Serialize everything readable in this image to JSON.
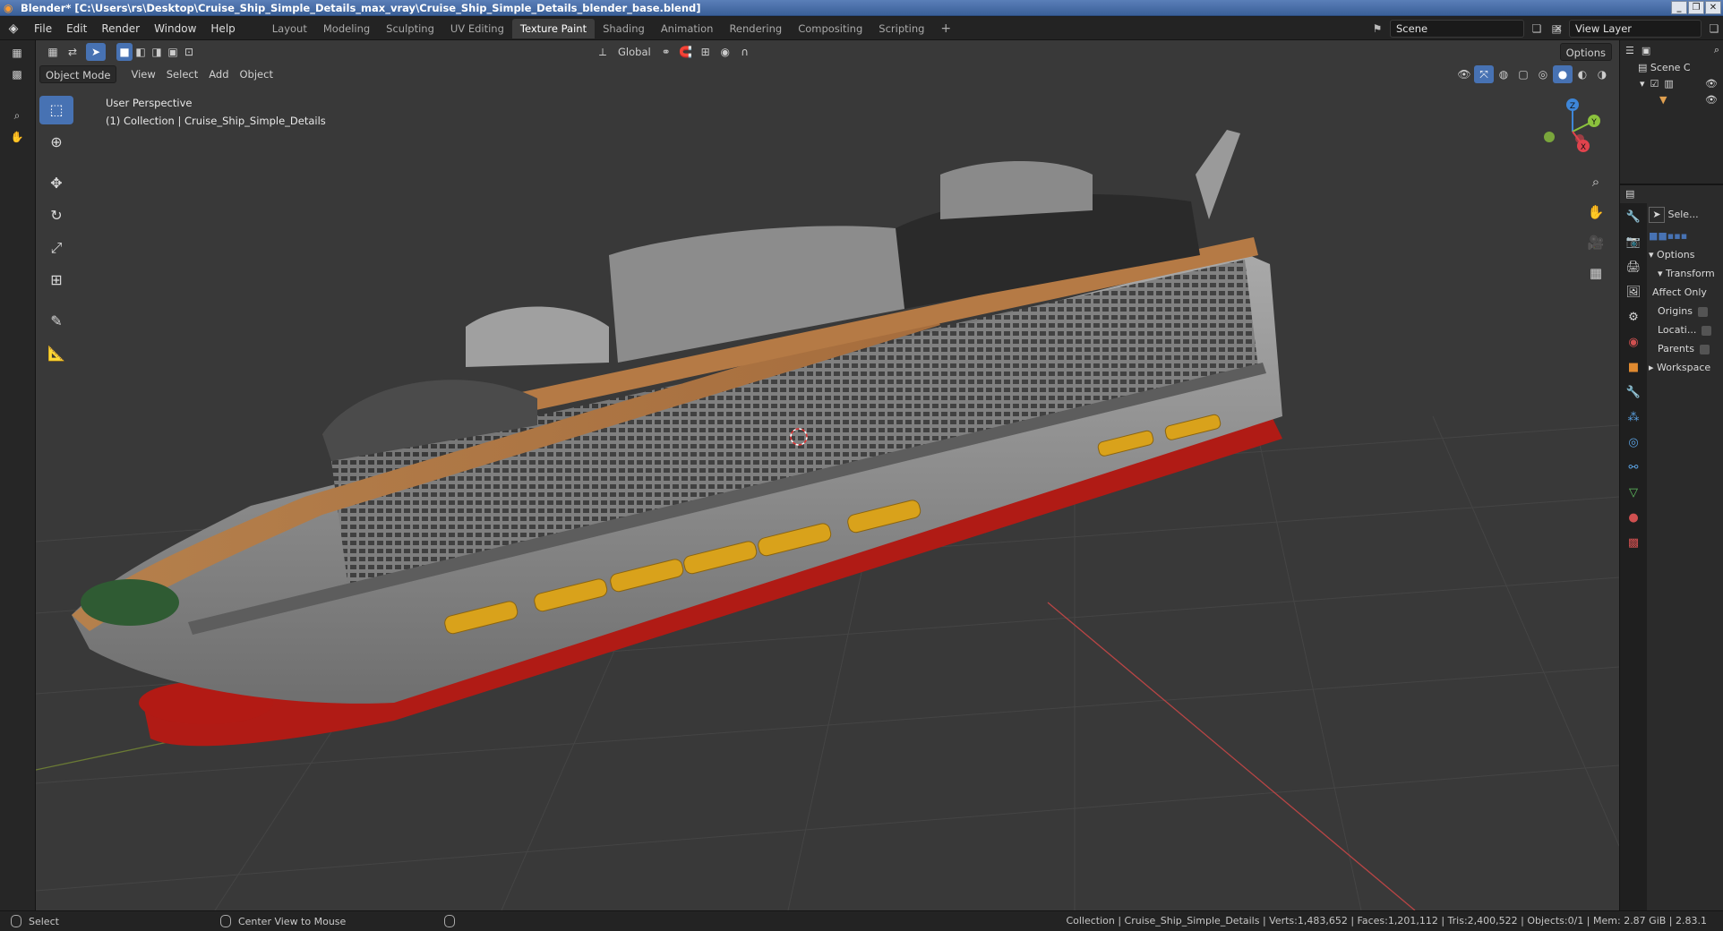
{
  "window": {
    "title": "Blender* [C:\\Users\\rs\\Desktop\\Cruise_Ship_Simple_Details_max_vray\\Cruise_Ship_Simple_Details_blender_base.blend]",
    "buttons": [
      "_",
      "❐",
      "✕"
    ]
  },
  "menu": [
    "File",
    "Edit",
    "Render",
    "Window",
    "Help"
  ],
  "workspaces": [
    {
      "label": "Layout",
      "active": false
    },
    {
      "label": "Modeling",
      "active": false
    },
    {
      "label": "Sculpting",
      "active": false
    },
    {
      "label": "UV Editing",
      "active": false
    },
    {
      "label": "Texture Paint",
      "active": true
    },
    {
      "label": "Shading",
      "active": false
    },
    {
      "label": "Animation",
      "active": false
    },
    {
      "label": "Rendering",
      "active": false
    },
    {
      "label": "Compositing",
      "active": false
    },
    {
      "label": "Scripting",
      "active": false
    }
  ],
  "scene": {
    "name": "Scene",
    "view_layer": "View Layer"
  },
  "viewport": {
    "mode": "Object Mode",
    "menus": [
      "View",
      "Select",
      "Add",
      "Object"
    ],
    "transform_orientation": "Global",
    "options_label": "Options",
    "overlay_line1": "User Perspective",
    "overlay_line2": "(1) Collection | Cruise_Ship_Simple_Details"
  },
  "gizmo": {
    "x": "X",
    "y": "Y",
    "z": "Z"
  },
  "outliner": {
    "scene_label": "Scene C"
  },
  "properties": {
    "select_label": "Sele...",
    "options_label": "Options",
    "transform_label": "Transform",
    "affect_only": "Affect Only",
    "origins": "Origins",
    "locations": "Locati...",
    "parents": "Parents",
    "workspace": "Workspace"
  },
  "status": {
    "left_select": "Select",
    "center_view": "Center View to Mouse",
    "right_info": "Collection | Cruise_Ship_Simple_Details | Verts:1,483,652 | Faces:1,201,112 | Tris:2,400,522 | Objects:0/1 | Mem: 2.87 GiB | 2.83.1"
  },
  "colors": {
    "active_blue": "#4772b3",
    "viewport_bg": "#393939",
    "hull": "#8e8e8e",
    "hull_red": "#b21a14",
    "deck_wood": "#b57a45",
    "lifeboat": "#d9a21b",
    "axis_x": "#e0434d",
    "axis_y": "#8bc23d",
    "axis_z": "#3e86d8"
  }
}
